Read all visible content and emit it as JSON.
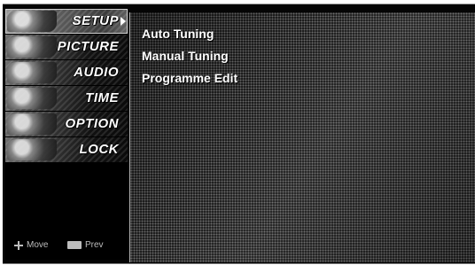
{
  "sidebar": {
    "categories": [
      {
        "label": "SETUP",
        "active": true
      },
      {
        "label": "PICTURE",
        "active": false
      },
      {
        "label": "AUDIO",
        "active": false
      },
      {
        "label": "TIME",
        "active": false
      },
      {
        "label": "OPTION",
        "active": false
      },
      {
        "label": "LOCK",
        "active": false
      }
    ]
  },
  "hints": {
    "move_label": "Move",
    "menu_key_icon": "menu-key-icon",
    "prev_label": "Prev"
  },
  "panel": {
    "items": [
      "Auto Tuning",
      "Manual Tuning",
      "Programme Edit"
    ]
  },
  "colors": {
    "menu_background": "#050505",
    "text": "#ffffff"
  }
}
